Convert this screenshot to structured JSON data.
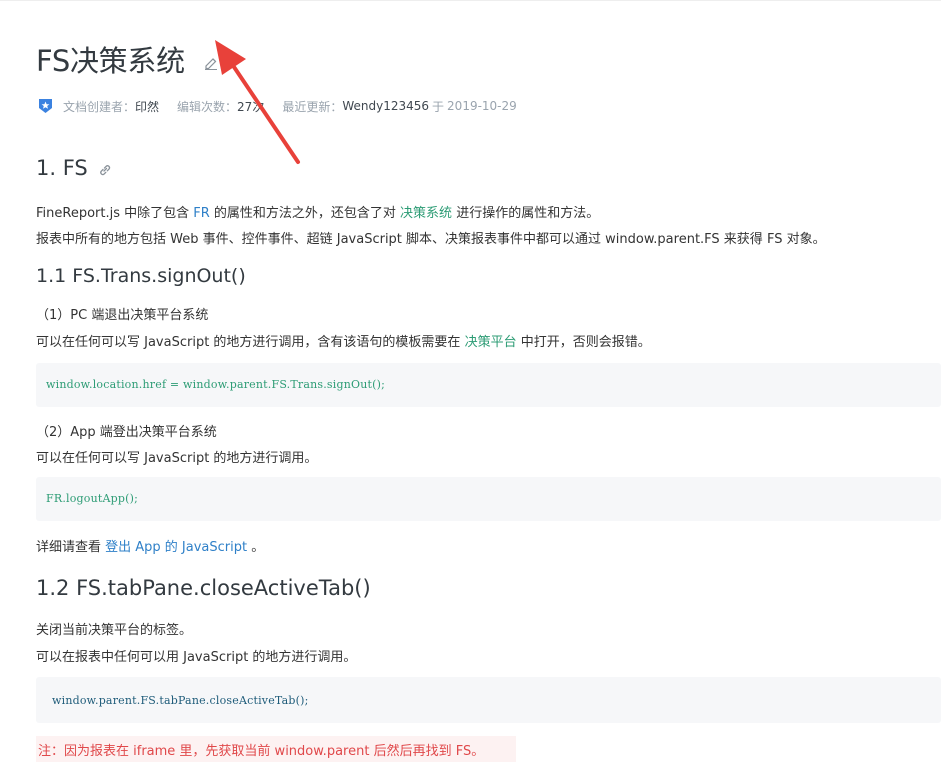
{
  "doc": {
    "title": "FS决策系统",
    "meta": {
      "creator_label": "文档创建者：",
      "creator": "印然",
      "edits_label": "编辑次数：",
      "edits": "27次",
      "updated_label": "最近更新：",
      "updated_by": "Wendy123456",
      "updated_sep": "于",
      "updated_date": "2019-10-29"
    }
  },
  "section1": {
    "heading": "1. FS",
    "intro_line1": {
      "pre": "FineReport.js 中除了包含 ",
      "link1": "FR",
      "mid": " 的属性和方法之外，还包含了对 ",
      "link2": "决策系统",
      "post": " 进行操作的属性和方法。"
    },
    "intro_line2": "报表中所有的地方包括 Web 事件、控件事件、超链 JavaScript 脚本、决策报表事件中都可以通过 window.parent.FS 来获得 FS 对象。"
  },
  "section1_1": {
    "heading": "1.1 FS.Trans.signOut()",
    "pc_title": "（1）PC 端退出决策平台系统",
    "pc_desc": {
      "pre": "可以在任何可以写 JavaScript 的地方进行调用，含有该语句的模板需要在 ",
      "link": "决策平台",
      "post": " 中打开，否则会报错。"
    },
    "pc_code": "window.location.href  =  window.parent.FS.Trans.signOut();",
    "app_title": "（2）App 端登出决策平台系统",
    "app_desc": "可以在任何可以写 JavaScript 的地方进行调用。",
    "app_code": "FR.logoutApp();",
    "detail": {
      "pre": "详细请查看 ",
      "link": "登出 App 的 JavaScript",
      "post": " 。"
    }
  },
  "section1_2": {
    "heading": "1.2 FS.tabPane.closeActiveTab()",
    "desc1": "关闭当前决策平台的标签。",
    "desc2": "可以在报表中任何可以用 JavaScript 的地方进行调用。",
    "code": "window.parent.FS.tabPane.closeActiveTab();",
    "note": "注：因为报表在 iframe 里，先获取当前 window.parent 后然后再找到 FS。"
  },
  "colors": {
    "link_blue": "#2f80c8",
    "link_green": "#2d9c75",
    "code_green": "#2d9c75",
    "note_red": "#e0484a",
    "arrow_red": "#e8413a"
  },
  "icons": {
    "edit": "pencil-edit-icon",
    "badge": "shield-star-icon",
    "anchor": "link-chain-icon"
  }
}
